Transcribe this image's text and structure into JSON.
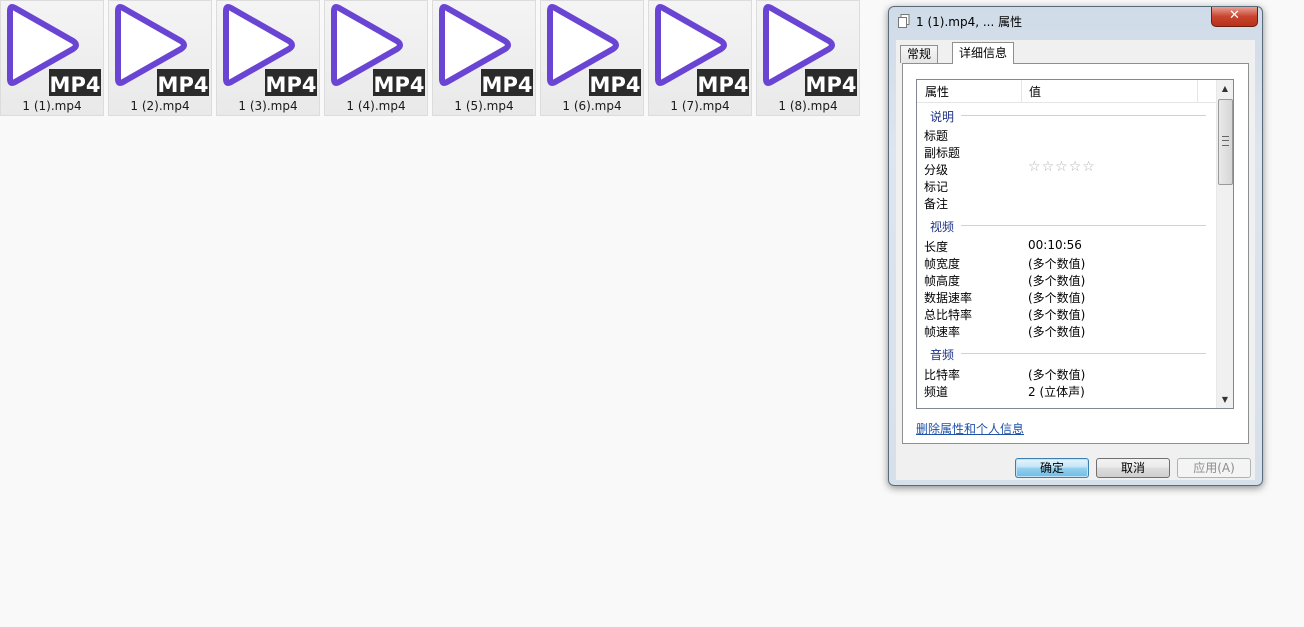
{
  "files": [
    {
      "name": "1 (1).mp4",
      "badge": "MP4"
    },
    {
      "name": "1 (2).mp4",
      "badge": "MP4"
    },
    {
      "name": "1 (3).mp4",
      "badge": "MP4"
    },
    {
      "name": "1 (4).mp4",
      "badge": "MP4"
    },
    {
      "name": "1 (5).mp4",
      "badge": "MP4"
    },
    {
      "name": "1 (6).mp4",
      "badge": "MP4"
    },
    {
      "name": "1 (7).mp4",
      "badge": "MP4"
    },
    {
      "name": "1 (8).mp4",
      "badge": "MP4"
    }
  ],
  "colors": {
    "play_icon": "#6a45d4",
    "badge_bg": "#2b2b2b",
    "group_text": "#1e3287",
    "link": "#1e52a8"
  },
  "dialog": {
    "title": "1 (1).mp4, ... 属性",
    "close_icon": "close-icon",
    "tabs": [
      {
        "label": "常规"
      },
      {
        "label": "详细信息"
      }
    ],
    "active_tab": "详细信息",
    "columns": {
      "property": "属性",
      "value": "值"
    },
    "groups": {
      "description": {
        "label": "说明",
        "rows": [
          {
            "name": "标题",
            "value": ""
          },
          {
            "name": "副标题",
            "value": ""
          },
          {
            "name": "分级",
            "value": "",
            "rating_stars": 0,
            "rating_max": 5
          },
          {
            "name": "标记",
            "value": ""
          },
          {
            "name": "备注",
            "value": ""
          }
        ]
      },
      "video": {
        "label": "视频",
        "rows": [
          {
            "name": "长度",
            "value": "00:10:56"
          },
          {
            "name": "帧宽度",
            "value": "(多个数值)"
          },
          {
            "name": "帧高度",
            "value": "(多个数值)"
          },
          {
            "name": "数据速率",
            "value": "(多个数值)"
          },
          {
            "name": "总比特率",
            "value": "(多个数值)"
          },
          {
            "name": "帧速率",
            "value": "(多个数值)"
          }
        ]
      },
      "audio": {
        "label": "音频",
        "rows": [
          {
            "name": "比特率",
            "value": "(多个数值)"
          },
          {
            "name": "频道",
            "value": "2 (立体声)"
          }
        ]
      }
    },
    "remove_link": "删除属性和个人信息",
    "buttons": {
      "ok": "确定",
      "cancel": "取消",
      "apply": "应用(A)"
    }
  }
}
